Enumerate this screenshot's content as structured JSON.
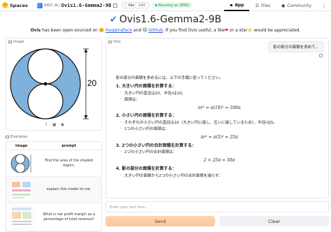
{
  "topbar": {
    "spaces_label": "Spaces",
    "org": "AIDC-AI",
    "repo": "Ovis1.6-Gemma2-9B",
    "like_label": "like",
    "like_count": "244",
    "status": "Running on ZERO",
    "tabs": [
      {
        "label": "App",
        "icon": "app-icon",
        "active": true
      },
      {
        "label": "Files",
        "icon": "files-icon",
        "active": false
      },
      {
        "label": "Community",
        "icon": "community-icon",
        "active": false
      }
    ]
  },
  "header": {
    "title": "Ovis1.6-Gemma2-9B",
    "subtitle_pre": "Ovis",
    "subtitle_1": " has been open-sourced on ",
    "huggingface": "Huggingface",
    "and": " and ",
    "github": "GitHub",
    "subtitle_2": ". If you find Ovis useful, a like",
    "subtitle_3": " or a star",
    "subtitle_4": " would be appreciated."
  },
  "image_panel": {
    "label": "Image",
    "dimension_label": "20"
  },
  "examples": {
    "label": "Examples",
    "col_image": "image",
    "col_prompt": "prompt",
    "rows": [
      {
        "prompt": "Find the area of the shaded region."
      },
      {
        "prompt": "explain this model to me."
      },
      {
        "prompt": "What is net profit margin as a percentage of total revenue?"
      }
    ]
  },
  "chat": {
    "label": "Ovis",
    "user_message": "影の部分の面積を求めて。",
    "intro": "影の部分の面積を求めるには、以下の手順に従ってください。",
    "steps": [
      {
        "heading": "1. 大きい円の面積を計算する：",
        "bullets": [
          "大きい円の直径は20、半径rは10。",
          "面積は："
        ],
        "math": "πr² = π(10)² = 100π"
      },
      {
        "heading": "2. 小さい円の面積を計算する：",
        "bullets": [
          "それぞれの小さい円の直径は10（大きい円に接し、互いに接しているため）、半径rは5。",
          "1つの小さい円の面積は："
        ],
        "math": "πr² = π(5)² = 25π"
      },
      {
        "heading": "3. 2つの小さい円の合計面積を計算する：",
        "bullets": [
          "2つの小さい円の合計面積は："
        ],
        "math": "2 × 25π = 50π"
      },
      {
        "heading": "4. 影の部分の面積を計算する：",
        "bullets": [
          "大きい円の面積から2つの小さい円の合計面積を減らす："
        ],
        "math": ""
      }
    ]
  },
  "input": {
    "placeholder": "Enter your text here..."
  },
  "buttons": {
    "send": "Send",
    "clear": "Clear"
  },
  "colors": {
    "accent_blue": "#2a7de1",
    "shaded": "#7fb1dd",
    "send_bg": "#fbc79b"
  }
}
